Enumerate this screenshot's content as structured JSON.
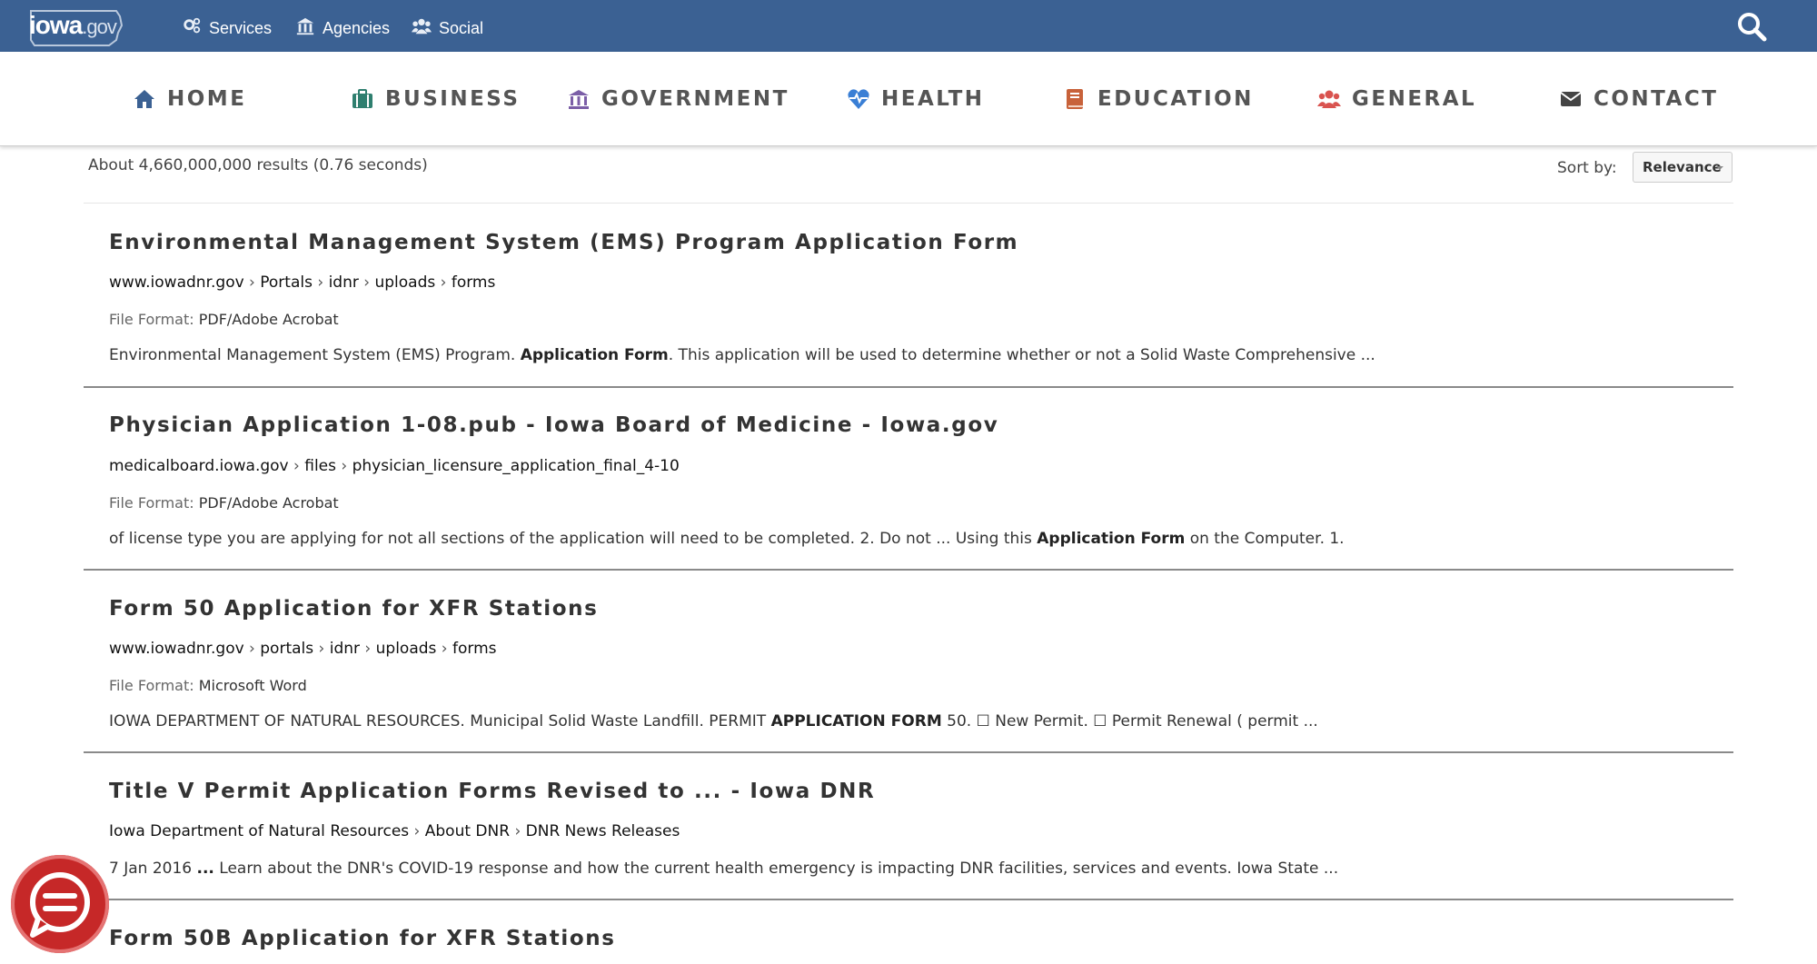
{
  "topbar": {
    "logo": {
      "main": "iowa",
      "suffix": ".gov"
    },
    "links": [
      {
        "label": "Services",
        "icon": "gears-icon"
      },
      {
        "label": "Agencies",
        "icon": "building-columns-icon"
      },
      {
        "label": "Social",
        "icon": "users-icon"
      }
    ],
    "search_icon": "search-icon",
    "color": "#3b6193"
  },
  "mainnav": {
    "items": [
      {
        "label": "HOME",
        "icon": "home-icon",
        "icon_color": "#3b6193"
      },
      {
        "label": "BUSINESS",
        "icon": "briefcase-icon",
        "icon_color": "#2f7f6f"
      },
      {
        "label": "GOVERNMENT",
        "icon": "building-columns-icon",
        "icon_color": "#7b5ea7"
      },
      {
        "label": "HEALTH",
        "icon": "heartbeat-icon",
        "icon_color": "#3a7fd5"
      },
      {
        "label": "EDUCATION",
        "icon": "book-icon",
        "icon_color": "#c8623a"
      },
      {
        "label": "GENERAL",
        "icon": "users-icon",
        "icon_color": "#d9534f"
      },
      {
        "label": "CONTACT",
        "icon": "envelope-icon",
        "icon_color": "#444444"
      }
    ]
  },
  "results_header": {
    "count_text": "About 4,660,000,000 results (0.76 seconds)",
    "sort_label": "Sort by:",
    "sort_value": "Relevance"
  },
  "results": [
    {
      "title": "Environmental Management System (EMS) Program Application Form",
      "breadcrumb": [
        "www.iowadnr.gov",
        "Portals",
        "idnr",
        "uploads",
        "forms"
      ],
      "format_label": "File Format:",
      "format_value": "PDF/Adobe Acrobat",
      "snippet_before": "Environmental Management System (EMS) Program. ",
      "snippet_bold": "Application Form",
      "snippet_after": ". This application will be used to determine whether or not a Solid Waste Comprehensive ..."
    },
    {
      "title": "Physician Application 1-08.pub - Iowa Board of Medicine - Iowa.gov",
      "breadcrumb": [
        "medicalboard.iowa.gov",
        "files",
        "physician_licensure_application_final_4-10"
      ],
      "format_label": "File Format:",
      "format_value": "PDF/Adobe Acrobat",
      "snippet_before": "of license type you are applying for not all sections of the application will need to be completed. 2. Do not ... Using this ",
      "snippet_bold": "Application Form",
      "snippet_after": " on the Computer. 1."
    },
    {
      "title": "Form 50 Application for XFR Stations",
      "breadcrumb": [
        "www.iowadnr.gov",
        "portals",
        "idnr",
        "uploads",
        "forms"
      ],
      "format_label": "File Format:",
      "format_value": "Microsoft Word",
      "snippet_before": "IOWA DEPARTMENT OF NATURAL RESOURCES. Municipal Solid Waste Landfill. PERMIT ",
      "snippet_bold": "APPLICATION FORM",
      "snippet_after": " 50. ☐ New Permit. ☐ Permit Renewal ( permit ..."
    },
    {
      "title": "Title V Permit Application Forms Revised to ... - Iowa DNR",
      "breadcrumb": [
        "Iowa Department of Natural Resources",
        "About DNR",
        "DNR News Releases"
      ],
      "snippet_before": "7 Jan 2016 ",
      "snippet_bold": "...",
      "snippet_after": " Learn about the DNR's COVID-19 response and how the current health emergency is impacting DNR facilities, services and events. Iowa State ..."
    },
    {
      "title": "Form 50B Application for XFR Stations"
    }
  ],
  "chat_button": {
    "icon": "chat-icon",
    "color": "#c62828"
  }
}
